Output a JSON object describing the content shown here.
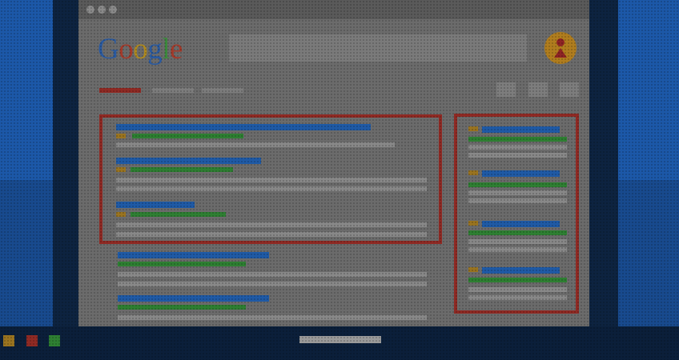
{
  "logo": {
    "letters": [
      "G",
      "o",
      "o",
      "g",
      "l",
      "e"
    ],
    "colors": [
      "#2a5aa0",
      "#a33a2a",
      "#b08a20",
      "#2a5aa0",
      "#3b8a3c",
      "#a33a2a"
    ]
  },
  "colors": {
    "ad_box_border": "#8f2a24",
    "title_bar": "#1f5aa6",
    "url_bar": "#2e7f32",
    "ad_badge": "#9a7420",
    "background": "#1c58a8"
  },
  "icons": {
    "avatar": "user-avatar-icon",
    "window_dots": "window-control-dots"
  }
}
